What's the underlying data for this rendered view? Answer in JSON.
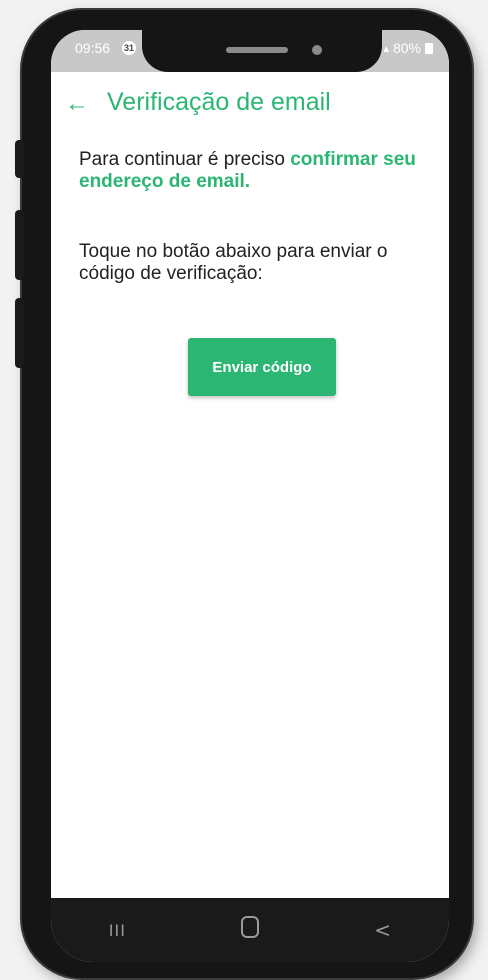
{
  "status_bar": {
    "time": "09:56",
    "notification_badge": "31",
    "battery": "80%",
    "signal_icon": "signal-icon",
    "battery_icon": "battery-icon"
  },
  "app_bar": {
    "back_icon": "←",
    "title": "Verificação de email"
  },
  "content": {
    "intro_prefix": "Para continuar é preciso ",
    "intro_emphasis": "confirmar seu endereço de email.",
    "instruction": "Toque no botão abaixo para enviar o código de verificação:",
    "send_button_label": "Enviar código"
  },
  "nav_bar": {
    "recents_glyph": "III",
    "back_glyph": "<"
  },
  "colors": {
    "accent": "#2bb673",
    "text": "#222222",
    "status_bar": "#c8c8c8",
    "nav_bar": "#1a1a1a"
  }
}
